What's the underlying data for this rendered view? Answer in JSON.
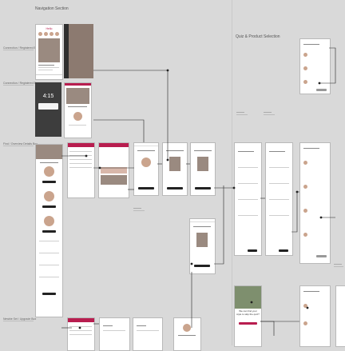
{
  "sections": {
    "navigation_title": "Navigation Section",
    "quiz_title": "Quiz & Product Selection"
  },
  "rows": [
    {
      "label": "Connection / Registered Box"
    },
    {
      "label": "Connection / Registered Box"
    },
    {
      "label": "Find / Overview Details Box"
    },
    {
      "label": "Newbie Set / Upgrade Box"
    }
  ],
  "screens": {
    "home_title": "Hello",
    "lock_time": "4:15",
    "quiz_heading": "We can find your style to skip the quiz?"
  },
  "colors": {
    "brand": "#b81d4f",
    "canvas": "#d9d9d9",
    "connector": "#222222"
  }
}
